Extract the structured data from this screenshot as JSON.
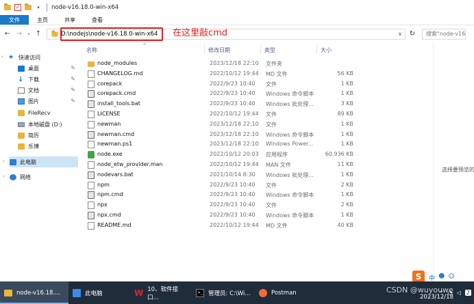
{
  "title": "node-v16.18.0-win-x64",
  "ribbon": {
    "tabs": [
      "文件",
      "主页",
      "共享",
      "查看"
    ]
  },
  "address": {
    "path": "D:\\nodejs\\node-v16.18.0-win-x64",
    "search_placeholder": "搜索\"node-v16..."
  },
  "annotation": "在这里敲cmd",
  "nav": {
    "quick_access": "快速访问",
    "items": [
      {
        "label": "桌面",
        "icon": "desktop-icon"
      },
      {
        "label": "下载",
        "icon": "download-icon"
      },
      {
        "label": "文档",
        "icon": "document-icon"
      },
      {
        "label": "图片",
        "icon": "picture-icon"
      },
      {
        "label": "FileRecv",
        "icon": "folder-icon"
      },
      {
        "label": "本地磁盘 (D:)",
        "icon": "drive-icon"
      },
      {
        "label": "简历",
        "icon": "folder-icon"
      },
      {
        "label": "乐博",
        "icon": "folder-icon"
      }
    ],
    "this_pc": "此电脑",
    "network": "网络"
  },
  "columns": {
    "name": "名称",
    "date": "修改日期",
    "type": "类型",
    "size": "大小"
  },
  "files": [
    {
      "name": "node_modules",
      "date": "2023/12/18 22:10",
      "type": "文件夹",
      "size": "",
      "kind": "folder"
    },
    {
      "name": "CHANGELOG.md",
      "date": "2022/10/12 19:44",
      "type": "MD 文件",
      "size": "56 KB",
      "kind": "file"
    },
    {
      "name": "corepack",
      "date": "2022/9/23 10:40",
      "type": "文件",
      "size": "1 KB",
      "kind": "file"
    },
    {
      "name": "corepack.cmd",
      "date": "2022/9/23 10:40",
      "type": "Windows 命令脚本",
      "size": "1 KB",
      "kind": "cmd"
    },
    {
      "name": "install_tools.bat",
      "date": "2022/9/23 10:40",
      "type": "Windows 批处理...",
      "size": "3 KB",
      "kind": "cmd"
    },
    {
      "name": "LICENSE",
      "date": "2022/10/12 19:44",
      "type": "文件",
      "size": "89 KB",
      "kind": "file"
    },
    {
      "name": "newman",
      "date": "2023/12/18 22:10",
      "type": "文件",
      "size": "1 KB",
      "kind": "file"
    },
    {
      "name": "newman.cmd",
      "date": "2023/12/18 22:10",
      "type": "Windows 命令脚本",
      "size": "1 KB",
      "kind": "cmd"
    },
    {
      "name": "newman.ps1",
      "date": "2023/12/18 22:10",
      "type": "Windows Power...",
      "size": "1 KB",
      "kind": "file"
    },
    {
      "name": "node.exe",
      "date": "2022/10/12 20:03",
      "type": "应用程序",
      "size": "60,936 KB",
      "kind": "exe"
    },
    {
      "name": "node_etw_provider.man",
      "date": "2022/10/12 19:44",
      "type": "MAN 文件",
      "size": "11 KB",
      "kind": "file"
    },
    {
      "name": "nodevars.bat",
      "date": "2021/10/14 8:30",
      "type": "Windows 批处理...",
      "size": "1 KB",
      "kind": "cmd"
    },
    {
      "name": "npm",
      "date": "2022/9/23 10:40",
      "type": "文件",
      "size": "2 KB",
      "kind": "file"
    },
    {
      "name": "npm.cmd",
      "date": "2022/9/23 10:40",
      "type": "Windows 命令脚本",
      "size": "1 KB",
      "kind": "cmd"
    },
    {
      "name": "npx",
      "date": "2022/9/23 10:40",
      "type": "文件",
      "size": "2 KB",
      "kind": "file"
    },
    {
      "name": "npx.cmd",
      "date": "2022/9/23 10:40",
      "type": "Windows 命令脚本",
      "size": "1 KB",
      "kind": "cmd"
    },
    {
      "name": "README.md",
      "date": "2022/10/12 19:44",
      "type": "MD 文件",
      "size": "40 KB",
      "kind": "file"
    }
  ],
  "preview_text": "选择要预览的",
  "taskbar": {
    "items": [
      {
        "label": "node-v16.18....",
        "icon": "folder-icon"
      },
      {
        "label": "此电脑",
        "icon": "pc-icon"
      },
      {
        "label": "10、软件接口...",
        "icon": "wps-icon"
      },
      {
        "label": "管理员: C:\\Wi...",
        "icon": "terminal-icon"
      },
      {
        "label": "Postman",
        "icon": "postman-icon"
      }
    ],
    "clock_date": "2023/12/18",
    "watermark": "CSDN @wuyouwe",
    "ime": "中"
  }
}
